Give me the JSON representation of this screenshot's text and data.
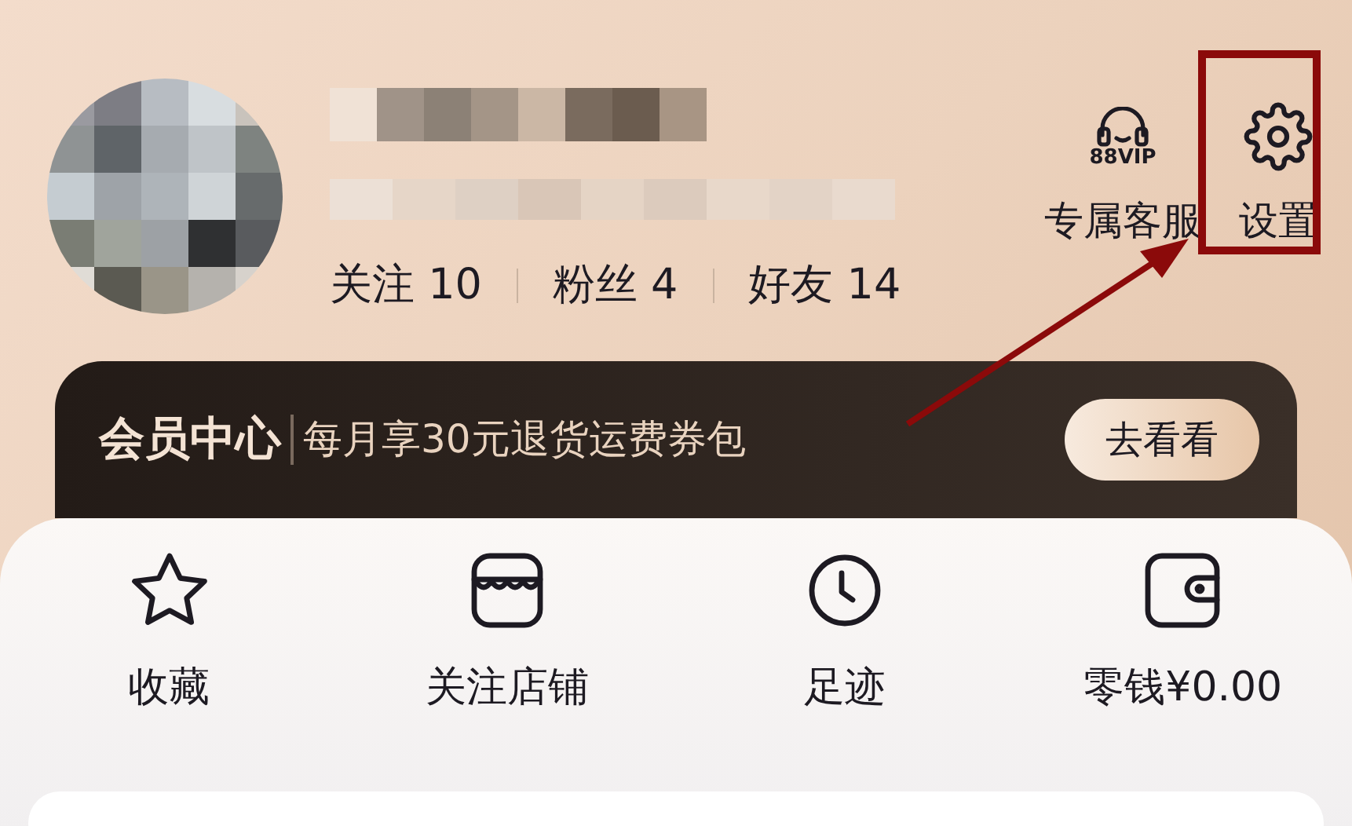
{
  "profile": {
    "stats": [
      {
        "label": "关注",
        "count": "10"
      },
      {
        "label": "粉丝",
        "count": "4"
      },
      {
        "label": "好友",
        "count": "14"
      }
    ]
  },
  "header_actions": [
    {
      "kind": "vip_service",
      "badge": "88VIP",
      "label": "专属客服",
      "highlighted": false
    },
    {
      "kind": "settings",
      "label": "设置",
      "highlighted": true
    }
  ],
  "member_banner": {
    "title": "会员中心",
    "text": "每月享30元退货运费券包",
    "button": "去看看"
  },
  "shortcuts": [
    {
      "kind": "star",
      "label": "收藏"
    },
    {
      "kind": "store",
      "label": "关注店铺"
    },
    {
      "kind": "clock",
      "label": "足迹"
    },
    {
      "kind": "wallet",
      "label": "零钱¥0.00"
    }
  ]
}
